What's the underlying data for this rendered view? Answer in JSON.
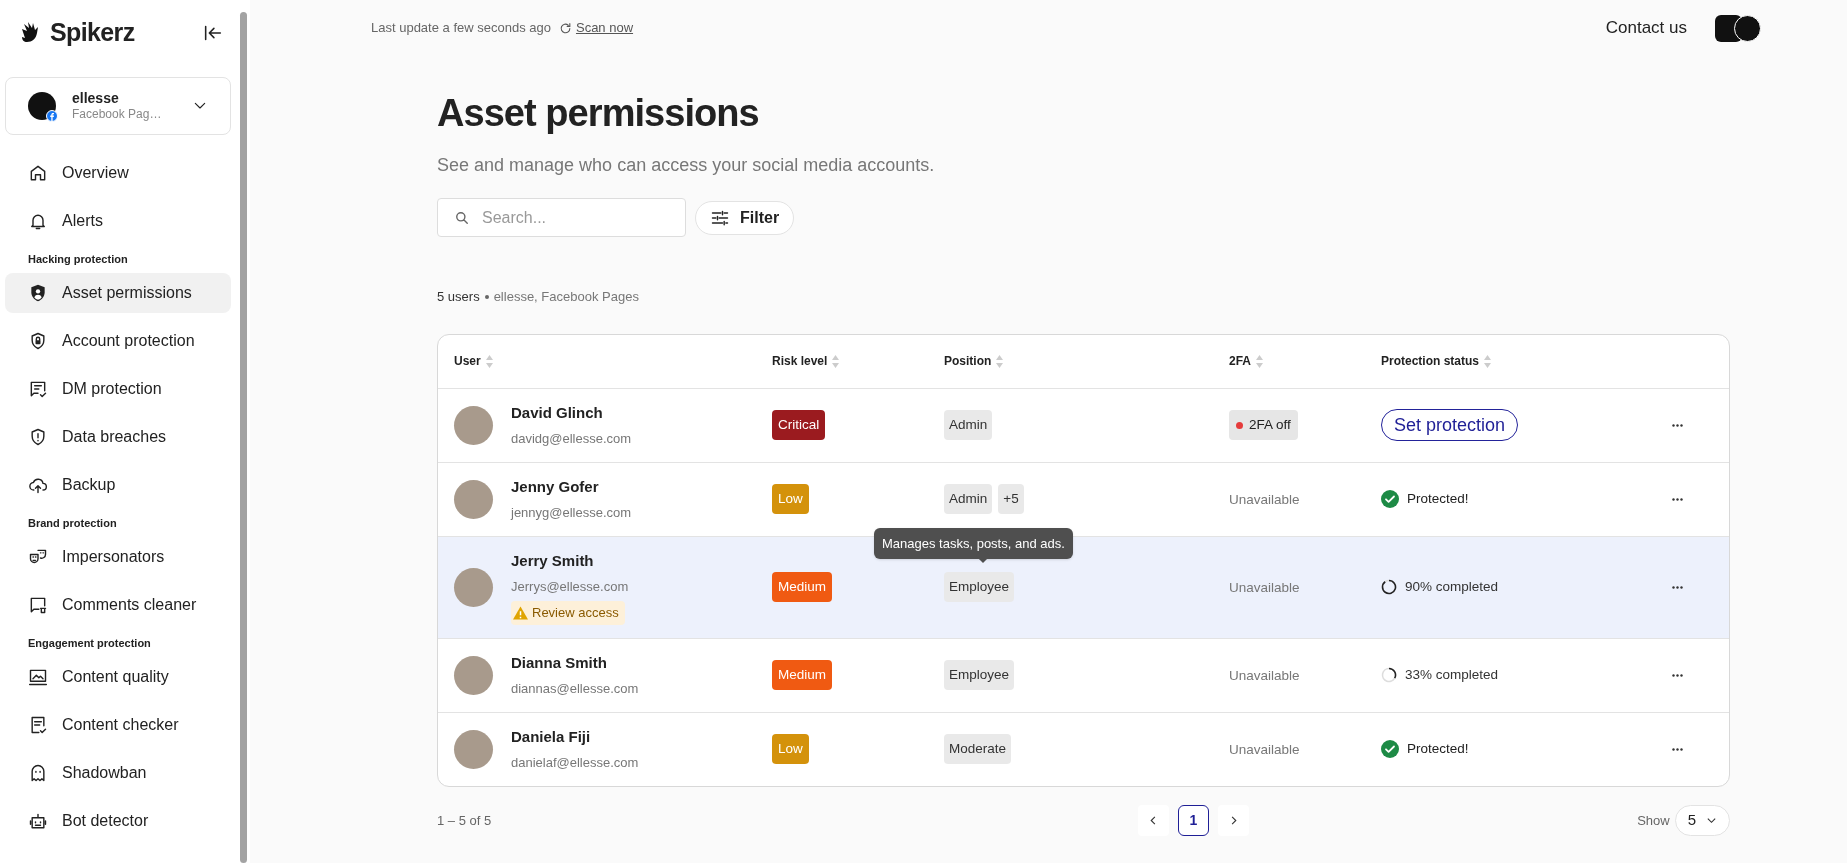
{
  "sidebar": {
    "brand": "Spikerz",
    "account": {
      "name": "ellesse",
      "type": "Facebook Pag…"
    },
    "items": [
      {
        "kind": "link",
        "label": "Overview",
        "selected": false
      },
      {
        "kind": "link",
        "label": "Alerts",
        "selected": false
      },
      {
        "kind": "section",
        "label": "Hacking protection"
      },
      {
        "kind": "link",
        "label": "Asset permissions",
        "selected": true
      },
      {
        "kind": "link",
        "label": "Account protection",
        "selected": false
      },
      {
        "kind": "link",
        "label": "DM protection",
        "selected": false
      },
      {
        "kind": "link",
        "label": "Data breaches",
        "selected": false
      },
      {
        "kind": "link",
        "label": "Backup",
        "selected": false
      },
      {
        "kind": "section",
        "label": "Brand protection"
      },
      {
        "kind": "link",
        "label": "Impersonators",
        "selected": false
      },
      {
        "kind": "link",
        "label": "Comments cleaner",
        "selected": false
      },
      {
        "kind": "section",
        "label": "Engagement protection"
      },
      {
        "kind": "link",
        "label": "Content quality",
        "selected": false
      },
      {
        "kind": "link",
        "label": "Content checker",
        "selected": false
      },
      {
        "kind": "link",
        "label": "Shadowban",
        "selected": false
      },
      {
        "kind": "link",
        "label": "Bot detector",
        "selected": false
      }
    ]
  },
  "topbar": {
    "last_update": "Last update a few seconds ago",
    "scan": "Scan now",
    "contact": "Contact us"
  },
  "page": {
    "title": "Asset permissions",
    "subtitle": "See and manage who can access your social media accounts.",
    "search": {
      "placeholder": "Search..."
    },
    "filter": "Filter",
    "count": "5 users",
    "scope": "ellesse, Facebook Pages"
  },
  "table": {
    "columns": [
      "User",
      "Risk level",
      "Position",
      "2FA",
      "Protection status"
    ],
    "rows": [
      {
        "hovered": false,
        "name": "David Glinch",
        "email": "davidg@ellesse.com",
        "risk": {
          "label": "Critical",
          "color": "#9b1b1f"
        },
        "position": [
          {
            "label": "Admin"
          }
        ],
        "twofa": {
          "kind": "off",
          "label": "2FA off"
        },
        "protection": {
          "kind": "button",
          "label": "Set protection"
        }
      },
      {
        "hovered": false,
        "name": "Jenny Gofer",
        "email": "jennyg@ellesse.com",
        "risk": {
          "label": "Low",
          "color": "#d4920b"
        },
        "position": [
          {
            "label": "Admin"
          },
          {
            "label": "+5"
          }
        ],
        "twofa": {
          "kind": "unavailable",
          "label": "Unavailable"
        },
        "protection": {
          "kind": "protected",
          "label": "Protected!"
        }
      },
      {
        "hovered": true,
        "name": "Jerry Smith",
        "email": "Jerrys@ellesse.com",
        "warning": "Review access",
        "risk": {
          "label": "Medium",
          "color": "#f05a12"
        },
        "position": [
          {
            "label": "Employee",
            "tooltip": "Manages tasks, posts, and ads."
          }
        ],
        "twofa": {
          "kind": "unavailable",
          "label": "Unavailable"
        },
        "protection": {
          "kind": "progress",
          "label": "90% completed",
          "level": 0.9
        }
      },
      {
        "hovered": false,
        "name": "Dianna Smith",
        "email": "diannas@ellesse.com",
        "risk": {
          "label": "Medium",
          "color": "#f05a12"
        },
        "position": [
          {
            "label": "Employee"
          }
        ],
        "twofa": {
          "kind": "unavailable",
          "label": "Unavailable"
        },
        "protection": {
          "kind": "progress",
          "label": "33% completed",
          "level": 0.33
        }
      },
      {
        "hovered": false,
        "name": "Daniela Fiji",
        "email": "danielaf@ellesse.com",
        "risk": {
          "label": "Low",
          "color": "#d4920b"
        },
        "position": [
          {
            "label": "Moderate"
          }
        ],
        "twofa": {
          "kind": "unavailable",
          "label": "Unavailable"
        },
        "protection": {
          "kind": "protected",
          "label": "Protected!"
        }
      }
    ]
  },
  "footer": {
    "range": "1 – 5 of 5",
    "pages": [
      {
        "label": "1",
        "selected": true
      }
    ],
    "show_label": "Show",
    "show_value": "5"
  }
}
